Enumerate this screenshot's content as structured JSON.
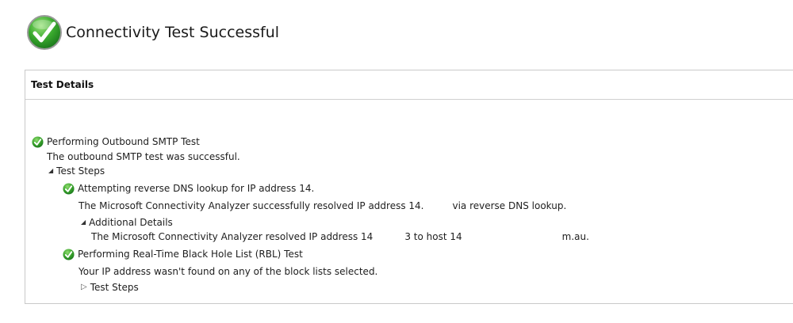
{
  "header": {
    "title": "Connectivity Test Successful",
    "status_icon": "success-check-icon"
  },
  "panel": {
    "heading": "Test Details"
  },
  "tree": {
    "outbound_test": {
      "label": "Performing Outbound SMTP Test",
      "result": "The outbound SMTP test was successful.",
      "steps_label": "Test Steps",
      "steps": {
        "reverse_dns": {
          "label": "Attempting reverse DNS lookup for IP address 14.",
          "result_prefix": "The Microsoft Connectivity Analyzer successfully resolved IP address 14.",
          "result_suffix": "via reverse DNS lookup.",
          "additional_label": "Additional Details",
          "additional_prefix": "The Microsoft Connectivity Analyzer resolved IP address 14",
          "additional_mid": "3 to host 14",
          "additional_suffix": "m.au."
        },
        "rbl": {
          "label": "Performing Real-Time Black Hole List (RBL) Test",
          "result": "Your IP address wasn't found on any of the block lists selected.",
          "steps_label": "Test Steps"
        }
      }
    }
  },
  "colors": {
    "success_green": "#3aaa2e",
    "border": "#c9c9c9"
  }
}
